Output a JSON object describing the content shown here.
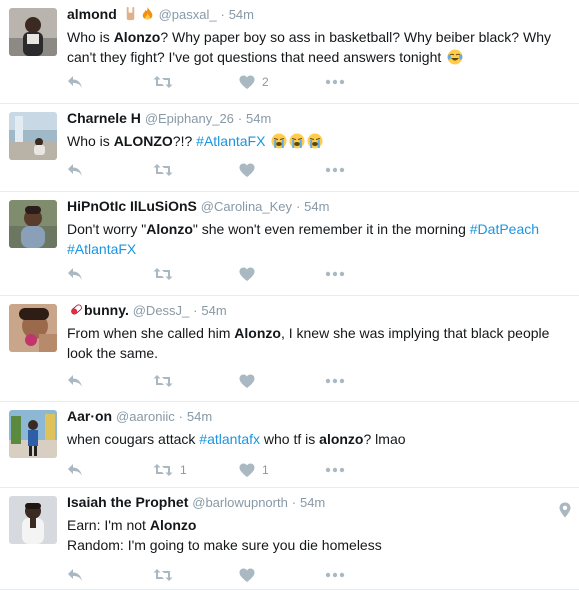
{
  "tweets": [
    {
      "name": "almond",
      "handle": "@pasxal_",
      "separator": "·",
      "time": "54m",
      "body": [
        "Who is ",
        {
          "b": "Alonzo"
        },
        "? Why paper boy so ass in basketball? Why beiber black? Why can't they fight? I've got questions that need answers tonight ",
        {
          "emoji": "joy"
        }
      ],
      "name_emojis": [
        "horns-hand-icon",
        "fire-icon"
      ],
      "retweets": "",
      "likes": "2"
    },
    {
      "name": "Charnele H",
      "handle": "@Epiphany_26",
      "separator": "·",
      "time": "54m",
      "body": [
        "Who is ",
        {
          "b": "ALONZO"
        },
        "?!? ",
        {
          "tag": "#AtlantaFX"
        },
        " ",
        {
          "emoji": "sob"
        },
        {
          "emoji": "sob"
        },
        {
          "emoji": "sob"
        }
      ],
      "retweets": "",
      "likes": ""
    },
    {
      "name": "HiPnOtIc IlLuSiOnS",
      "handle": "@Carolina_Key",
      "separator": "·",
      "time": "54m",
      "body": [
        "Don't worry \"",
        {
          "b": "Alonzo"
        },
        "\" she won't even remember it in the morning ",
        {
          "tag": "#DatPeach"
        },
        " ",
        {
          "tag": "#AtlantaFX"
        }
      ],
      "retweets": "",
      "likes": ""
    },
    {
      "name": "bunny.",
      "handle": "@DessJ_",
      "separator": "·",
      "time": "54m",
      "body": [
        "From when she called him ",
        {
          "b": "Alonzo"
        },
        ", I knew she was implying that black people look the same."
      ],
      "name_emojis_before": [
        "pill-icon"
      ],
      "retweets": "",
      "likes": ""
    },
    {
      "name": "Aar·on",
      "handle": "@aaroniic",
      "separator": "·",
      "time": "54m",
      "body": [
        "when cougars attack ",
        {
          "tag": "#atlantafx"
        },
        " who tf is ",
        {
          "b": "alonzo"
        },
        "? lmao"
      ],
      "retweets": "1",
      "likes": "1"
    },
    {
      "name": "Isaiah the Prophet",
      "handle": "@barlowupnorth",
      "separator": "·",
      "time": "54m",
      "body": [
        "Earn: I'm not ",
        {
          "b": "Alonzo"
        },
        {
          "br": true
        },
        "Random: I'm going to make sure you die homeless"
      ],
      "retweets": "",
      "likes": "",
      "geo": "location-pin-icon"
    }
  ],
  "icons": {
    "reply": "reply-icon",
    "retweet": "retweet-icon",
    "like": "heart-icon",
    "more": "more-icon"
  },
  "colors": {
    "name": "#14171a",
    "meta": "#8899a6",
    "link": "#1b95e0",
    "action_icon": "#aab8c2",
    "divider": "#e6ecf0"
  }
}
